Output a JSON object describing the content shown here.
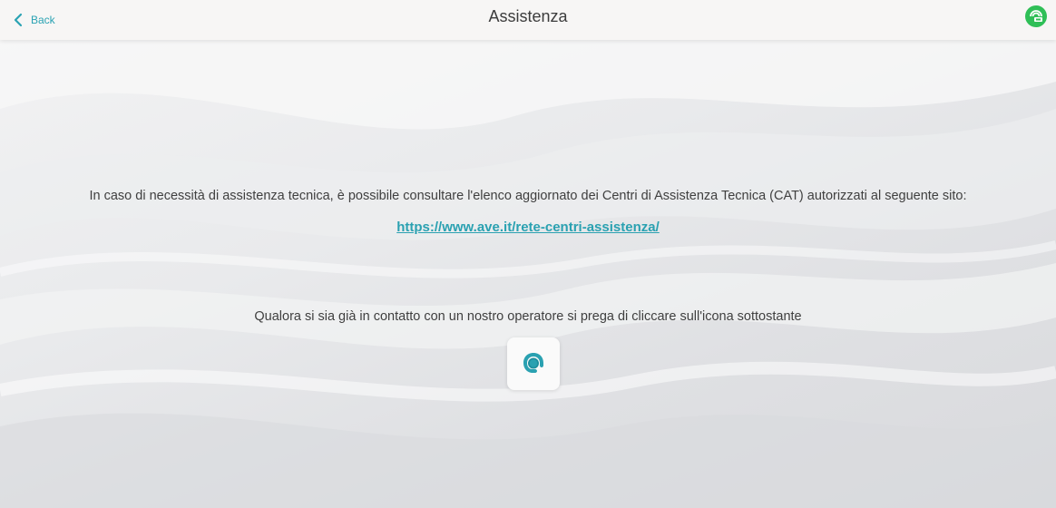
{
  "header": {
    "back_label": "Back",
    "title": "Assistenza",
    "status_icon": "connection-status-icon"
  },
  "main": {
    "info_text": "In caso di necessità di assistenza tecnica, è possibile consultare l'elenco aggiornato dei Centri di Assistenza Tecnica (CAT) autorizzati al seguente sito:",
    "link_text": "https://www.ave.it/rete-centri-assistenza/",
    "contact_text": "Qualora si sia già in contatto con un nostro operatore si prega di cliccare sull'icona sottostante",
    "operator_icon": "operator-headset-icon"
  },
  "colors": {
    "accent": "#2aa1b1",
    "status_green": "#2fbf57",
    "text": "#3f3f3f",
    "header_bg": "#f6f5f4"
  }
}
